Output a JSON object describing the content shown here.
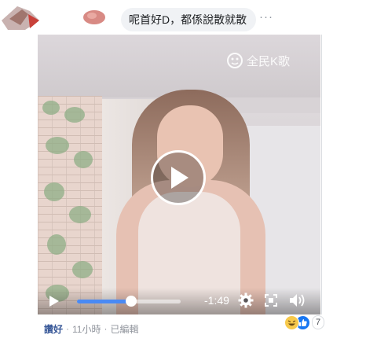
{
  "comment": {
    "caption": "呢首好D，都係說散就散",
    "more_icon": "more-dots-icon",
    "more_label": "···"
  },
  "video": {
    "watermark": "全民K歌",
    "current_time": "-1:49",
    "progress_fraction": 0.52,
    "icons": {
      "play_overlay": "play-circle-icon",
      "play": "play-icon",
      "settings": "gear-icon",
      "fullscreen": "fullscreen-icon",
      "volume": "volume-icon"
    }
  },
  "footer": {
    "like_label": "讚好",
    "dot1": "·",
    "time": "11小時",
    "dot2": "·",
    "edited": "已編輯"
  },
  "reactions": {
    "count": "7",
    "icons": [
      "haha-reaction-icon",
      "like-reaction-icon"
    ]
  },
  "colors": {
    "link": "#385898",
    "progress": "#4a8af4",
    "bubble": "#f0f2f5"
  }
}
